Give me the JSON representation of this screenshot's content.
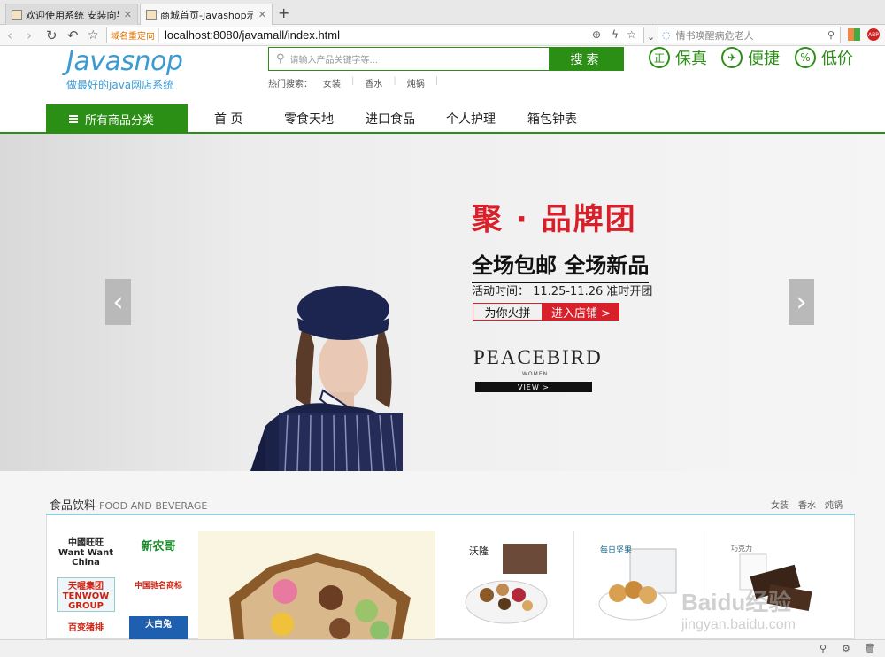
{
  "browser": {
    "tabs": [
      {
        "label": "欢迎使用系统 安装向导",
        "active": false
      },
      {
        "label": "商城首页-Javashop示例商城",
        "active": true
      }
    ],
    "new_tab": "+",
    "url_tag": "域名重定向",
    "url_host": "localhost",
    "url_rest": ":8080/javamall/index.html",
    "search_placeholder": "情书唤醒病危老人"
  },
  "header": {
    "logo": "Javasnop",
    "slogan": "做最好的java网店系统",
    "search_placeholder": "请输入产品关键字等...",
    "search_button": "搜索",
    "hot_label": "热门搜索：",
    "hot_terms": [
      "女装",
      "香水",
      "炖锅"
    ],
    "promises": [
      {
        "icon": "正",
        "label": "保真"
      },
      {
        "icon": "✈",
        "label": "便捷"
      },
      {
        "icon": "%",
        "label": "低价"
      }
    ]
  },
  "nav": {
    "all_categories": "所有商品分类",
    "items": [
      "首 页",
      "零食天地",
      "进口食品",
      "个人护理",
      "箱包钟表"
    ]
  },
  "banner": {
    "title": "聚 · 品牌团",
    "subtitle": "全场包邮 全场新品",
    "time": "活动时间：  11.25-11.26  准时开团",
    "btn1": "为你火拼",
    "btn2": "进入店铺 >",
    "brand": "PEACEBIRD",
    "brand_sub": "WOMEN",
    "view": "VIEW  >",
    "prev": "‹",
    "next": "›"
  },
  "section": {
    "title": "食品饮料",
    "title_en": "FOOD AND BEVERAGE",
    "links": [
      "女装",
      "香水",
      "炖锅"
    ],
    "brands": [
      "中國旺旺 Want Want China",
      "新农哥",
      "天喔集团 TENWOW GROUP",
      "中国驰名商标",
      "百变猪排",
      "大白兔"
    ],
    "products": [
      "沃隆",
      "每日坚果",
      "巧克力"
    ]
  },
  "watermark": {
    "line1": "Baidu经验",
    "line2": "jingyan.baidu.com"
  }
}
